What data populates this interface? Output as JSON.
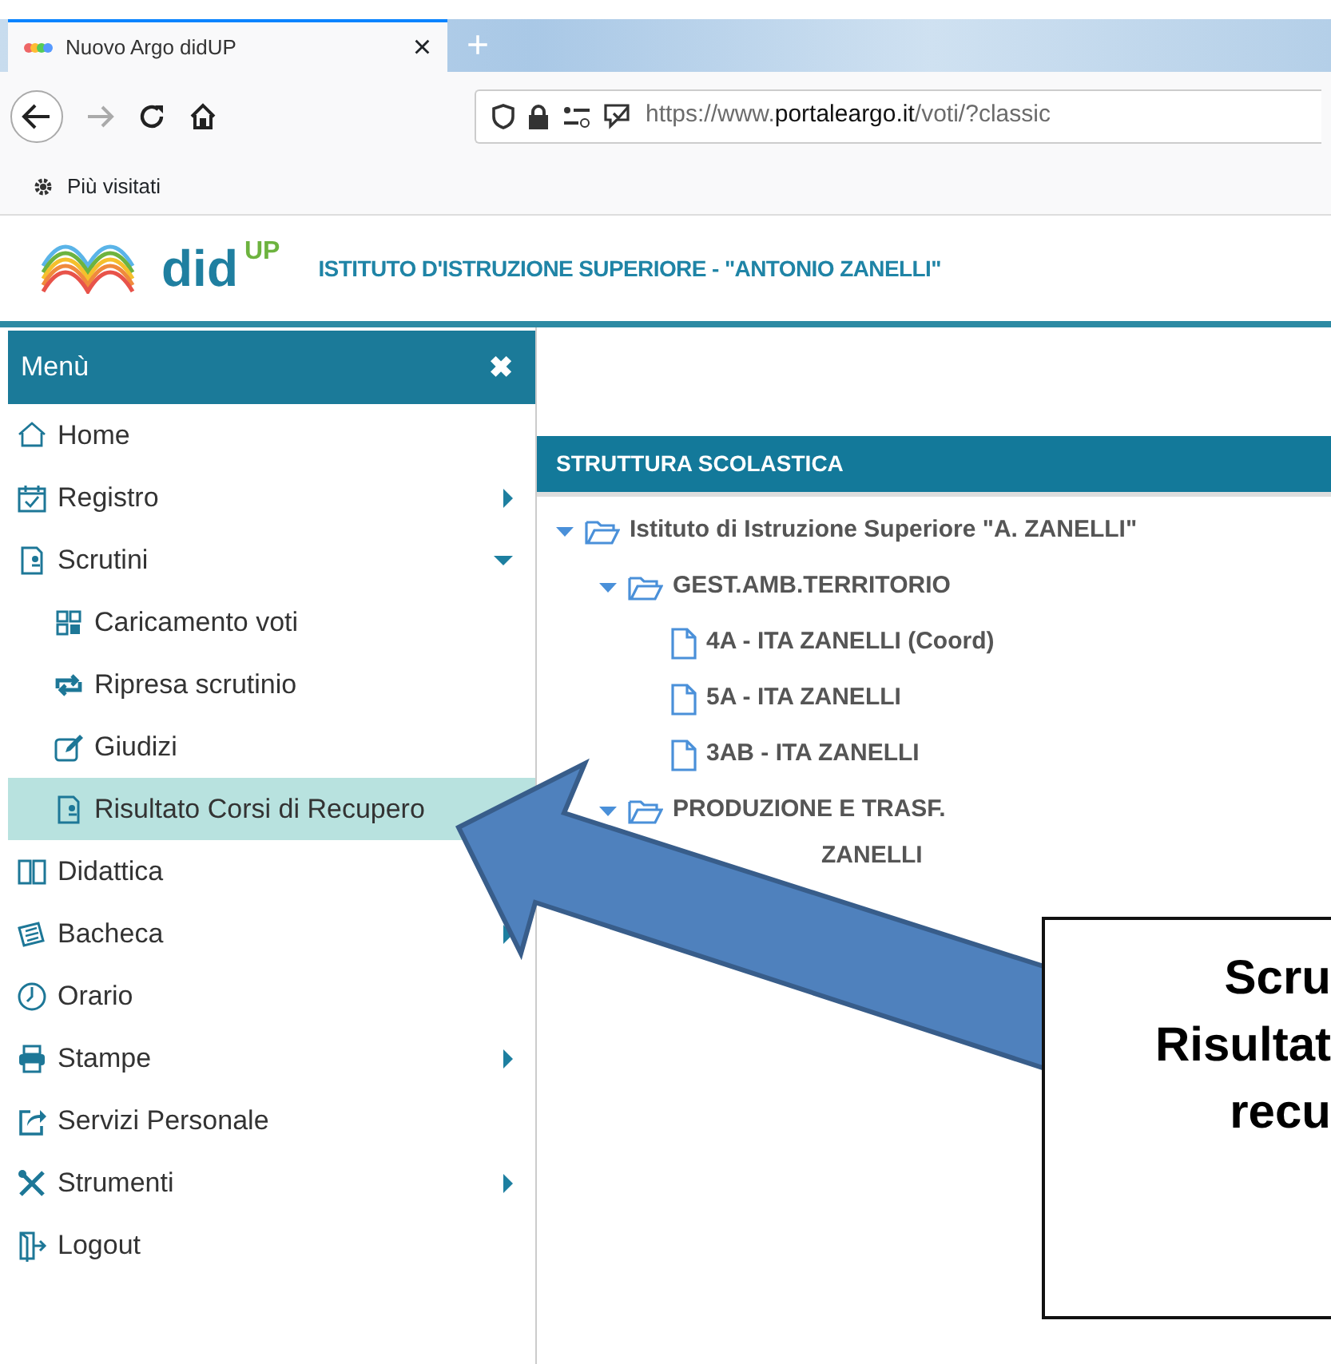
{
  "browser": {
    "tab_title": "Nuovo Argo didUP",
    "close": "×",
    "new_tab": "+",
    "url": {
      "prefix": "https://www.",
      "domain": "portaleargo.it",
      "path": "/voti/?classic"
    },
    "bookmarks": [
      "Più visitati"
    ]
  },
  "header": {
    "logo_text": "did",
    "logo_sup": "UP",
    "school": "ISTITUTO D'ISTRUZIONE SUPERIORE - \"ANTONIO ZANELLI\""
  },
  "sidebar": {
    "title": "Menù",
    "close": "✖",
    "items": [
      {
        "label": "Home",
        "selected": false
      },
      {
        "label": "Registro",
        "expanded": false,
        "selected": false
      },
      {
        "label": "Scrutini",
        "expanded": true,
        "selected": false,
        "children": [
          {
            "label": "Caricamento voti",
            "selected": false
          },
          {
            "label": "Ripresa scrutinio",
            "selected": false
          },
          {
            "label": "Giudizi",
            "selected": false
          },
          {
            "label": "Risultato Corsi di Recupero",
            "selected": true
          }
        ]
      },
      {
        "label": "Didattica",
        "selected": false
      },
      {
        "label": "Bacheca",
        "expanded": false,
        "selected": false
      },
      {
        "label": "Orario",
        "selected": false
      },
      {
        "label": "Stampe",
        "expanded": false,
        "selected": false
      },
      {
        "label": "Servizi Personale",
        "selected": false
      },
      {
        "label": "Strumenti",
        "expanded": false,
        "selected": false
      },
      {
        "label": "Logout",
        "selected": false
      }
    ]
  },
  "tree": {
    "title": "STRUTTURA SCOLASTICA",
    "nodes": [
      {
        "label": "Istituto di Istruzione Superiore \"A. ZANELLI\"",
        "kind": "folder",
        "expanded": true,
        "children": [
          {
            "label": "GEST.AMB.TERRITORIO",
            "kind": "folder",
            "expanded": true,
            "children": [
              {
                "label": "4A - ITA ZANELLI (Coord)",
                "kind": "file"
              },
              {
                "label": "5A - ITA ZANELLI",
                "kind": "file"
              },
              {
                "label": "3AB - ITA ZANELLI",
                "kind": "file"
              }
            ]
          },
          {
            "label": "PRODUZIONE E TRASF.",
            "kind": "folder",
            "expanded": true,
            "children": [
              {
                "label": "ZANELLI",
                "kind": "hidden-file"
              }
            ]
          }
        ]
      }
    ]
  },
  "annotation": {
    "lines": [
      "Scru",
      "Risultat",
      "recu"
    ]
  }
}
